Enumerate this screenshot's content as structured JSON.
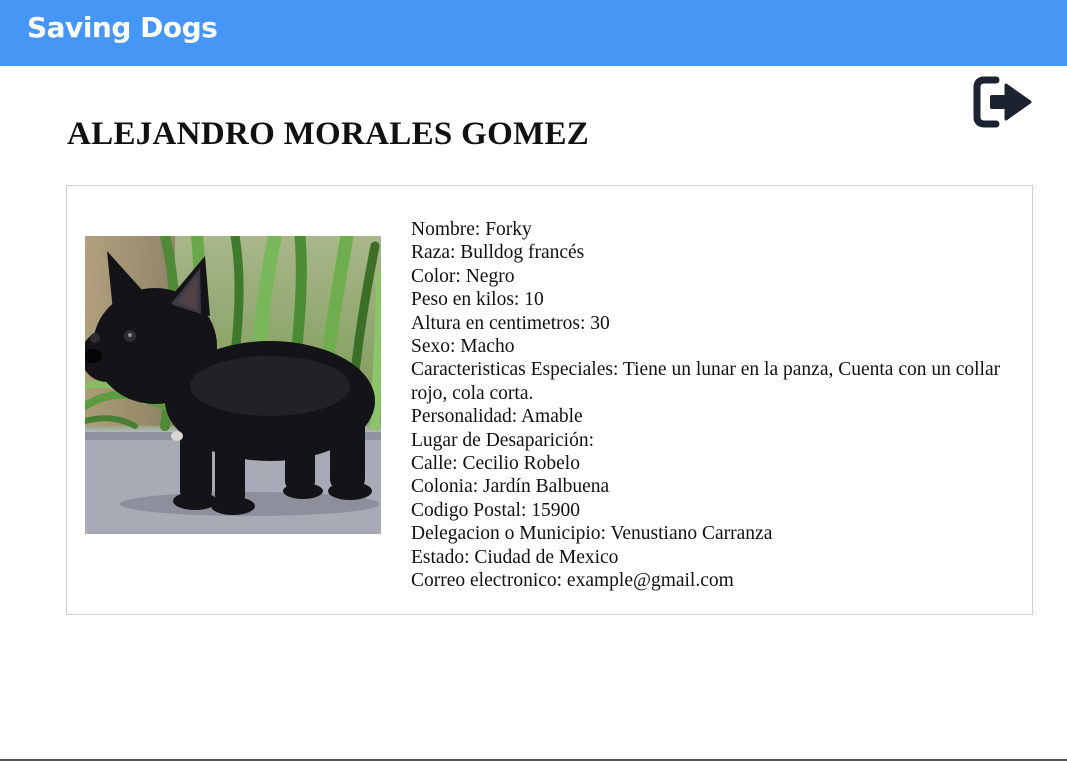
{
  "app": {
    "brand": "Saving Dogs",
    "accent_color": "#4596f5",
    "logout_icon": "sign-out-icon"
  },
  "owner": {
    "name": "ALEJANDRO MORALES GOMEZ"
  },
  "dog": {
    "photo_description_icon": "dog-photo",
    "lines": [
      "Nombre: Forky",
      "Raza: Bulldog francés",
      "Color: Negro",
      "Peso en kilos: 10",
      "Altura en centimetros: 30",
      "Sexo: Macho",
      "Caracteristicas Especiales: Tiene un lunar en la panza, Cuenta con un collar rojo, cola corta.",
      "Personalidad: Amable",
      "Lugar de Desaparición:",
      "Calle: Cecilio Robelo",
      "Colonia: Jardín Balbuena",
      "Codigo Postal: 15900",
      "Delegacion o Municipio: Venustiano Carranza",
      "Estado: Ciudad de Mexico",
      "Correo electronico: example@gmail.com"
    ]
  }
}
